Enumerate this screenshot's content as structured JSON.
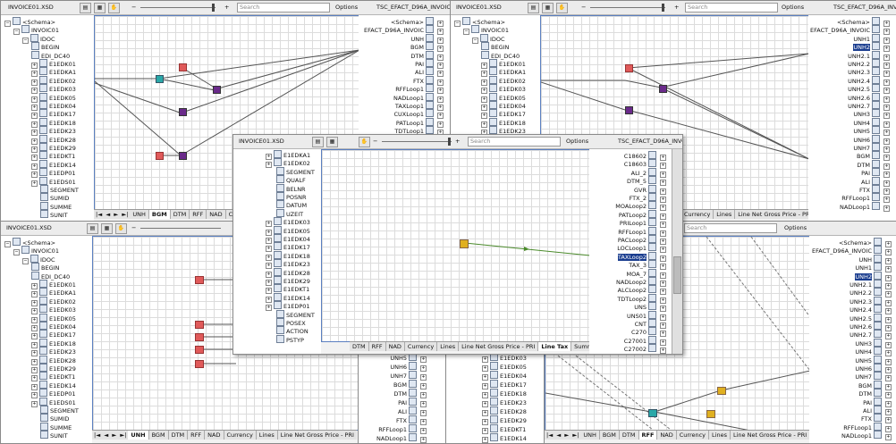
{
  "toolbar": {
    "search_placeholder": "Search",
    "options_label": "Options",
    "zoom_out": "−",
    "zoom_in": "+"
  },
  "panels": {
    "tl": {
      "source_title": "INVOICE01.XSD",
      "target_title": "TSC_EFACT_D96A_INVOIC"
    },
    "tr": {
      "source_title": "INVOICE01.XSD",
      "target_title": "TSC_EFACT_D96A_INVOIC"
    },
    "bl": {
      "source_title": "INVOICE01.XSD"
    },
    "center": {
      "source_title": "INVOICE01.XSD",
      "target_title": "TSC_EFACT_D96A_INVOIC"
    }
  },
  "source_tree": [
    "<Schema>",
    "INVOIC01",
    "IDOC",
    "BEGIN",
    "EDI_DC40",
    "E1EDK01",
    "E1EDKA1",
    "E1EDK02",
    "E1EDK03",
    "E1EDK05",
    "E1EDK04",
    "E1EDK17",
    "E1EDK18",
    "E1EDK23",
    "E1EDK28",
    "E1EDK29",
    "E1EDKT1",
    "E1EDK14",
    "E1EDP01",
    "E1EDS01",
    "SEGMENT",
    "SUMID",
    "SUMME",
    "SUNIT"
  ],
  "center_tree": [
    "E1EDKA1",
    "E1EDK02",
    "SEGMENT",
    "QUALF",
    "BELNR",
    "POSNR",
    "DATUM",
    "UZEIT",
    "E1EDK03",
    "E1EDK05",
    "E1EDK04",
    "E1EDK17",
    "E1EDK18",
    "E1EDK23",
    "E1EDK28",
    "E1EDK29",
    "E1EDKT1",
    "E1EDK14",
    "E1EDP01",
    "SEGMENT",
    "POSEX",
    "ACTION",
    "PSTYP"
  ],
  "center_target": [
    "C18602",
    "C18603",
    "ALI_2",
    "DTM_5",
    "GVR",
    "FTX_2",
    "MOALoop2",
    "PATLoop2",
    "PRILoop1",
    "RFFLoop1",
    "PACLoop2",
    "LOCLoop1",
    "TAXLoop2",
    "TAX_3",
    "MOA_7",
    "NADLoop2",
    "ALCLoop2",
    "TDTLoop2",
    "UNS",
    "UNS01",
    "CNT",
    "C270",
    "C27001",
    "C27002"
  ],
  "tl_target": [
    "<Schema>",
    "EFACT_D96A_INVOIC",
    "UNH",
    "BGM",
    "DTM",
    "PAI",
    "ALI",
    "FTX",
    "RFFLoop1",
    "NADLoop1",
    "TAXLoop1",
    "CUXLoop1",
    "PATLoop1",
    "TDTLoop1"
  ],
  "tr_target": [
    "<Schema>",
    "EFACT_D96A_INVOIC",
    "UNH1",
    "UNH2",
    "UNH2.1",
    "UNH2.2",
    "UNH2.3",
    "UNH2.4",
    "UNH2.5",
    "UNH2.6",
    "UNH2.7",
    "UNH3",
    "UNH4",
    "UNH5",
    "UNH6",
    "UNH7",
    "BGM",
    "DTM",
    "PAI",
    "ALI",
    "FTX",
    "RFFLoop1",
    "NADLoop1"
  ],
  "br_target": [
    "<Schema>",
    "EFACT_D96A_INVOIC",
    "UNH",
    "UNH1",
    "UNH2",
    "UNH2.1",
    "UNH2.2",
    "UNH2.3",
    "UNH2.4",
    "UNH2.5",
    "UNH2.6",
    "UNH2.7",
    "UNH3",
    "UNH4",
    "UNH5",
    "UNH6",
    "UNH7",
    "BGM",
    "DTM",
    "PAI",
    "ALI",
    "FTX",
    "RFFLoop1",
    "NADLoop1"
  ],
  "bm_target": [
    "UNH5",
    "UNH6",
    "UNH7",
    "BGM",
    "DTM",
    "PAI",
    "ALI",
    "FTX",
    "RFFLoop1",
    "NADLoop1"
  ],
  "bm2_source": [
    "E1EDK03",
    "E1EDK05",
    "E1EDK04",
    "E1EDK17",
    "E1EDK18",
    "E1EDK23",
    "E1EDK28",
    "E1EDK29",
    "E1EDKT1",
    "E1EDK14"
  ],
  "tabs": {
    "tl": [
      "UNH",
      "BGM",
      "DTM",
      "RFF",
      "NAD",
      "Cu"
    ],
    "center": [
      "DTM",
      "RFF",
      "NAD",
      "Currency",
      "Lines",
      "Line Net Gross Price - PRI",
      "Line Tax",
      "Summ"
    ],
    "bl": [
      "UNH",
      "BGM",
      "DTM",
      "RFF",
      "NAD",
      "Currency",
      "Lines",
      "Line Net Gross Price - PRI",
      "Lo"
    ],
    "tr": [
      "Currency",
      "Lines",
      "Line Net Gross Price - PRI"
    ],
    "br": [
      "UNH",
      "BGM",
      "DTM",
      "RFF",
      "NAD",
      "Currency",
      "Lines",
      "Line Net Gross Price - PRI"
    ]
  },
  "tab_active": {
    "tl": "BGM",
    "center": "Line Tax",
    "bl": "UNH",
    "br": "RFF"
  },
  "nav_arrows": [
    "|◄",
    "◄",
    "►",
    "►|"
  ],
  "colors": {
    "link": "#1a3d8f",
    "function_red": "#e05a5a",
    "function_purple": "#6a2a8a",
    "function_teal": "#2aa8a8",
    "function_yellow": "#e0b020",
    "mapping_green": "#4a8a2a"
  }
}
